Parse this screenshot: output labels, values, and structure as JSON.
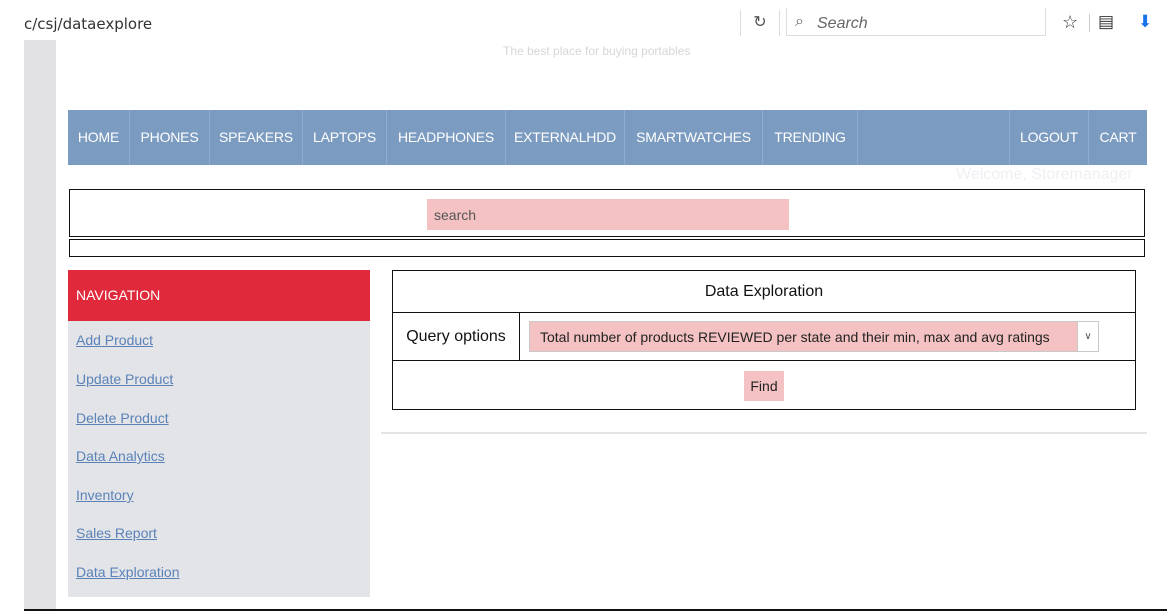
{
  "browser": {
    "url": "c/csj/dataexplore",
    "search_placeholder": "Search",
    "reload_icon": "reload-icon",
    "star_icon": "bookmark-star-icon",
    "list_icon": "reader-list-icon",
    "download_icon": "download-arrow-icon"
  },
  "header": {
    "tagline": "The best place for buying portables",
    "welcome": "Welcome, Storemanager"
  },
  "nav": {
    "items": [
      {
        "label": "HOME"
      },
      {
        "label": "PHONES"
      },
      {
        "label": "SPEAKERS"
      },
      {
        "label": "LAPTOPS"
      },
      {
        "label": "HEADPHONES"
      },
      {
        "label": "EXTERNALHDD"
      },
      {
        "label": "SMARTWATCHES"
      },
      {
        "label": "TRENDING"
      },
      {
        "label": "LOGOUT"
      },
      {
        "label": "CART"
      }
    ]
  },
  "search": {
    "placeholder": "search"
  },
  "sidebar": {
    "heading": "NAVIGATION",
    "links": [
      {
        "label": "Add Product"
      },
      {
        "label": "Update Product"
      },
      {
        "label": "Delete Product"
      },
      {
        "label": "Data Analytics"
      },
      {
        "label": "Inventory"
      },
      {
        "label": "Sales Report"
      },
      {
        "label": "Data Exploration"
      }
    ]
  },
  "main": {
    "title": "Data Exploration",
    "query_label": "Query options",
    "query_selected": "Total number of products REVIEWED per state and their min, max and avg ratings",
    "find_label": "Find"
  },
  "colors": {
    "nav_bg": "#7b9bc0",
    "sidebar_head": "#e0293a",
    "sidebar_bg": "#e3e4e8",
    "pink_field": "#f4c2c2",
    "link": "#5a82b8"
  }
}
